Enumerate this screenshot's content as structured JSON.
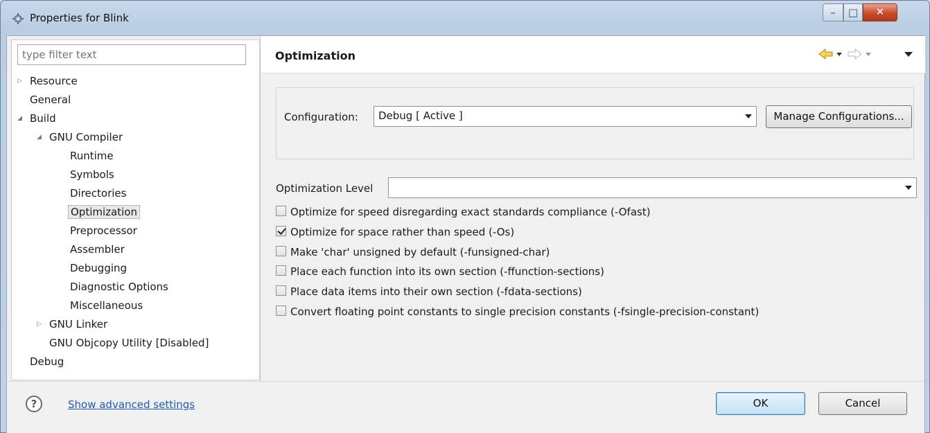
{
  "window": {
    "title": "Properties for Blink"
  },
  "filter": {
    "placeholder": "type filter text"
  },
  "tree": {
    "resource": "Resource",
    "general": "General",
    "build": "Build",
    "gnu_compiler": "GNU Compiler",
    "runtime": "Runtime",
    "symbols": "Symbols",
    "directories": "Directories",
    "optimization": "Optimization",
    "preprocessor": "Preprocessor",
    "assembler": "Assembler",
    "debugging": "Debugging",
    "diagnostic_options": "Diagnostic Options",
    "miscellaneous": "Miscellaneous",
    "gnu_linker": "GNU Linker",
    "gnu_objcopy": "GNU Objcopy Utility  [Disabled]",
    "debug": "Debug"
  },
  "page": {
    "title": "Optimization"
  },
  "configuration": {
    "label": "Configuration:",
    "value": "Debug  [ Active ]",
    "manage_label": "Manage Configurations..."
  },
  "optimization_level": {
    "label": "Optimization Level",
    "value": ""
  },
  "options": {
    "ofast": {
      "label": "Optimize for speed disregarding exact standards compliance (-Ofast)",
      "checked": false
    },
    "os": {
      "label": "Optimize for space rather than speed (-Os)",
      "checked": true
    },
    "unsigned_char": {
      "label": "Make 'char' unsigned by default (-funsigned-char)",
      "checked": false
    },
    "function_sections": {
      "label": "Place each function into its own section (-ffunction-sections)",
      "checked": false
    },
    "data_sections": {
      "label": "Place data items into their own section (-fdata-sections)",
      "checked": false
    },
    "single_precision": {
      "label": "Convert floating point constants to single precision constants (-fsingle-precision-constant)",
      "checked": false
    }
  },
  "footer": {
    "advanced_link": "Show advanced settings",
    "ok_label": "OK",
    "cancel_label": "Cancel"
  },
  "colors": {
    "link": "#1e5bb6",
    "close_button": "#c9492a",
    "nav_arrow": "#e8b400"
  }
}
